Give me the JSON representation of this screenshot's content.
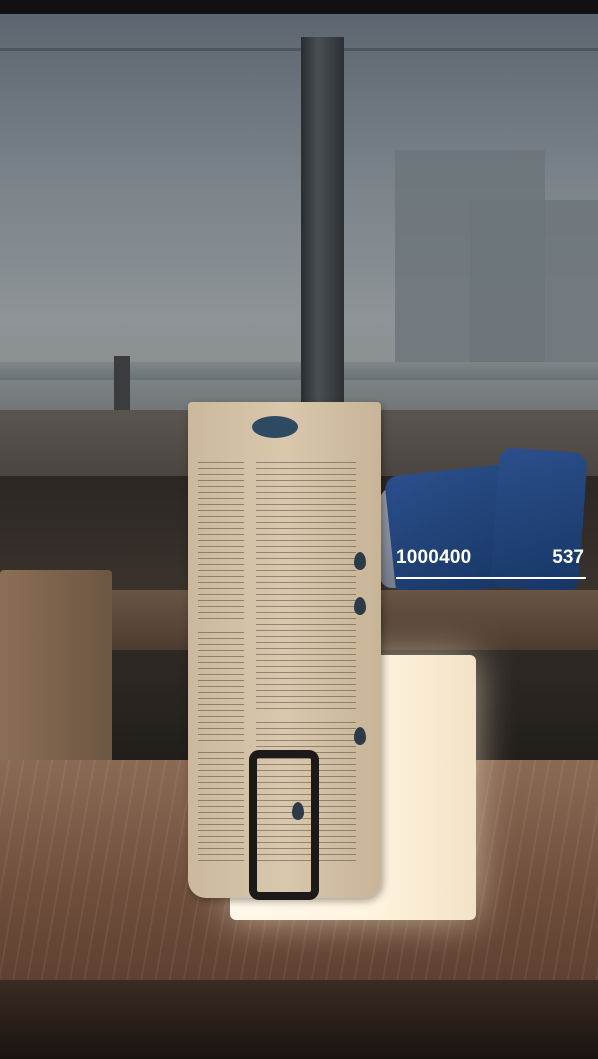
{
  "photo": {
    "subject": "menu-board-on-lit-cube-lamp",
    "colors": {
      "cushion": "#1f4075",
      "lamp_glow": "#fff5e2",
      "menu_board": "#d2bfa3",
      "label_text": "#ffffff"
    }
  },
  "label": {
    "code": "1000400",
    "number": "537"
  }
}
